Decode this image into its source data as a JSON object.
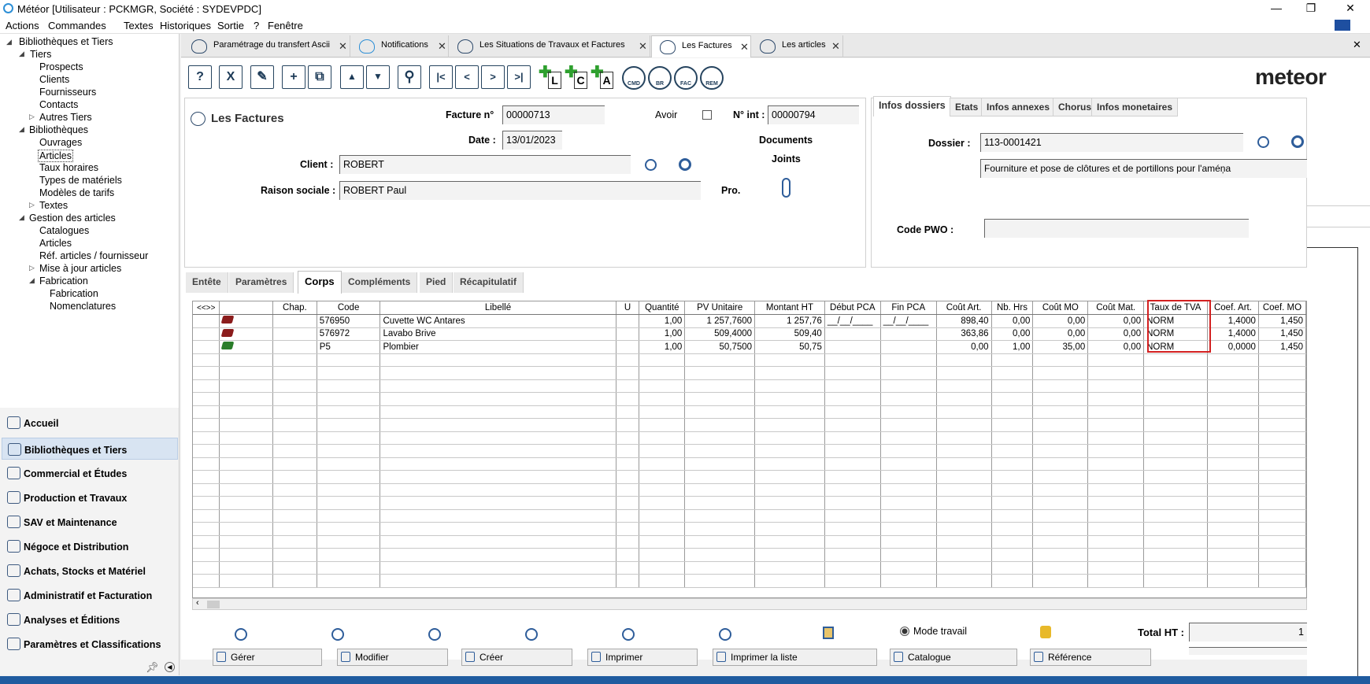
{
  "window": {
    "title": "Météor [Utilisateur : PCKMGR, Société : SYDEVPDC]",
    "min": "—",
    "max": "❐",
    "close": "✕"
  },
  "menu": [
    "Actions",
    "Commandes",
    "Textes",
    "Historiques",
    "Sortie",
    "?",
    "Fenêtre"
  ],
  "tree": [
    "Bibliothèques et Tiers",
    "Tiers",
    "Prospects",
    "Clients",
    "Fournisseurs",
    "Contacts",
    "Autres Tiers",
    "Bibliothèques",
    "Ouvrages",
    "Articles",
    "Taux horaires",
    "Types de matériels",
    "Modèles de tarifs",
    "Textes",
    "Gestion des articles",
    "Catalogues",
    "Articles",
    "Réf. articles / fournisseur",
    "Mise à jour articles",
    "Fabrication",
    "Fabrication",
    "Nomenclatures"
  ],
  "nav": [
    "Accueil",
    "Bibliothèques et Tiers",
    "Commercial et Études",
    "Production et Travaux",
    "SAV et Maintenance",
    "Négoce et Distribution",
    "Achats, Stocks et Matériel",
    "Administratif et Facturation",
    "Analyses et Éditions",
    "Paramètres et Classifications"
  ],
  "doc_tabs": [
    "Paramétrage du transfert Ascii",
    "Notifications",
    "Les Situations de Travaux et Factures",
    "Les Factures",
    "Les articles"
  ],
  "toolbar": {
    "help": "?",
    "delete": "X",
    "edit": "✎",
    "add": "+",
    "copy": "⧉",
    "up": "▲",
    "down": "▼",
    "search": "⚲",
    "first": "|<",
    "prev": "<",
    "next": ">",
    "last": ">|",
    "new_l": "L",
    "new_c": "C",
    "new_a": "A",
    "cmd": "CMD",
    "br": "BR",
    "fac": "FAC",
    "rem": "REM"
  },
  "logo": "meteor",
  "form": {
    "title": "Les Factures",
    "facture_label": "Facture n°",
    "facture_value": "00000713",
    "avoir_label": "Avoir",
    "nint_label": "N° int :",
    "nint_value": "00000794",
    "date_label": "Date :",
    "date_value": "13/01/2023",
    "documents_label": "Documents",
    "joints_label": "Joints",
    "client_label": "Client :",
    "client_value": "ROBERT",
    "raison_label": "Raison sociale :",
    "raison_value": "ROBERT Paul",
    "pro_label": "Pro."
  },
  "info": {
    "tabs": [
      "Infos dossiers",
      "Etats",
      "Infos annexes",
      "Chorus",
      "Infos monetaires"
    ],
    "dossier_label": "Dossier :",
    "dossier_value": "113-0001421",
    "dossier_desc": "Fourniture et pose de clôtures et de portillons pour l'améņa",
    "pwo_label": "Code PWO :",
    "pwo_value": ""
  },
  "lower_tabs": [
    "Entête",
    "Paramètres",
    "Corps",
    "Compléments",
    "Pied",
    "Récapitulatif"
  ],
  "grid": {
    "nav_label": "<<>>",
    "columns": [
      "Chap.",
      "Code",
      "Libellé",
      "U",
      "Quantité",
      "PV Unitaire",
      "Montant HT",
      "Début PCA",
      "Fin PCA",
      "Coût Art.",
      "Nb. Hrs",
      "Coût MO",
      "Coût Mat.",
      "Taux de TVA",
      "Coef. Art.",
      "Coef. MO"
    ],
    "rows": [
      {
        "icon": "book-red",
        "chap": "",
        "code": "576950",
        "libelle": "Cuvette WC Antares",
        "u": "",
        "qte": "1,00",
        "pvu": "1 257,7600",
        "mht": "1 257,76",
        "deb": "__/__/____",
        "fin": "__/__/____",
        "cart": "898,40",
        "nbh": "0,00",
        "cmo": "0,00",
        "cmat": "0,00",
        "tva": "NORM",
        "coefa": "1,4000",
        "coefmo": "1,450"
      },
      {
        "icon": "book-red",
        "chap": "",
        "code": "576972",
        "libelle": "Lavabo Brive",
        "u": "",
        "qte": "1,00",
        "pvu": "509,4000",
        "mht": "509,40",
        "deb": "",
        "fin": "",
        "cart": "363,86",
        "nbh": "0,00",
        "cmo": "0,00",
        "cmat": "0,00",
        "tva": "NORM",
        "coefa": "1,4000",
        "coefmo": "1,450"
      },
      {
        "icon": "book-green",
        "chap": "",
        "code": "P5",
        "libelle": "Plombier",
        "u": "",
        "qte": "1,00",
        "pvu": "50,7500",
        "mht": "50,75",
        "deb": "",
        "fin": "",
        "cart": "0,00",
        "nbh": "1,00",
        "cmo": "35,00",
        "cmat": "0,00",
        "tva": "NORM",
        "coefa": "0,0000",
        "coefmo": "1,450"
      }
    ]
  },
  "bottom": {
    "mode_label": "Mode travail",
    "total_ht_label": "Total HT :",
    "total_ht_value": "1",
    "buttons": [
      "Gérer",
      "Modifier",
      "Créer",
      "Imprimer",
      "Imprimer la liste",
      "Catalogue",
      "Référence"
    ]
  },
  "colors": {
    "highlight": "#d32020",
    "accent": "#2e5d9a",
    "taskbar": "#1f5b9f"
  }
}
